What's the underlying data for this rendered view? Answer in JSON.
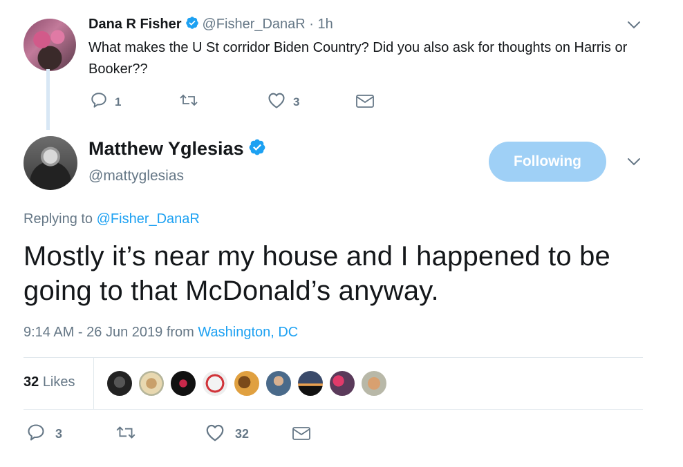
{
  "parent_tweet": {
    "display_name": "Dana R Fisher",
    "handle": "@Fisher_DanaR",
    "separator": "·",
    "time": "1h",
    "text": "What makes the U St corridor Biden Country?  Did you also ask for thoughts on Harris or Booker??",
    "reply_count": "1",
    "retweet_count": "",
    "like_count": "3"
  },
  "main_tweet": {
    "display_name": "Matthew Yglesias",
    "handle": "@mattyglesias",
    "follow_label": "Following",
    "replying_prefix": "Replying to",
    "replying_to": "@Fisher_DanaR",
    "text": "Mostly it’s near my house and I happened to be going to that McDonald’s anyway.",
    "timestamp": "9:14 AM - 26 Jun 2019",
    "from_label": "from",
    "location": "Washington, DC",
    "likes_number": "32",
    "likes_label": "Likes",
    "reply_count": "3",
    "retweet_count": "",
    "like_count": "32"
  },
  "colors": {
    "accent": "#1da1f2",
    "muted": "#657786",
    "follow_button": "#9fd0f6",
    "thread_line": "#d8e7f5"
  },
  "icons": [
    "verified-badge-icon",
    "chevron-down-icon",
    "reply-icon",
    "retweet-icon",
    "heart-icon",
    "direct-message-icon"
  ]
}
